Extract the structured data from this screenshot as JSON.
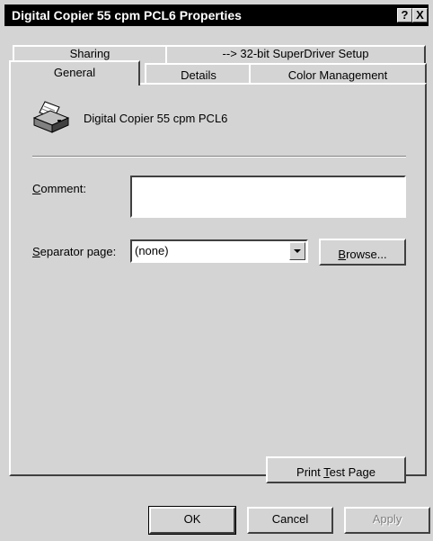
{
  "window": {
    "title": "Digital Copier 55 cpm PCL6 Properties",
    "help_btn": "?",
    "close_btn": "X"
  },
  "tabs_back": [
    {
      "label": "Sharing"
    },
    {
      "label": "--> 32-bit SuperDriver Setup"
    }
  ],
  "tabs_front": [
    {
      "label": "General",
      "selected": true
    },
    {
      "label": "Details"
    },
    {
      "label": "Color Management"
    }
  ],
  "general": {
    "printer_name": "Digital Copier 55 cpm PCL6",
    "printer_icon": "printer-icon",
    "comment_label_first": "C",
    "comment_label_rest": "omment:",
    "comment_value": "",
    "separator_label_first": "S",
    "separator_label_rest": "eparator page:",
    "separator_value": "(none)",
    "browse_first": "B",
    "browse_rest": "rowse...",
    "print_test_pre": "Print ",
    "print_test_u": "T",
    "print_test_post": "est Page"
  },
  "footer": {
    "ok": "OK",
    "cancel": "Cancel",
    "apply": "Apply"
  }
}
